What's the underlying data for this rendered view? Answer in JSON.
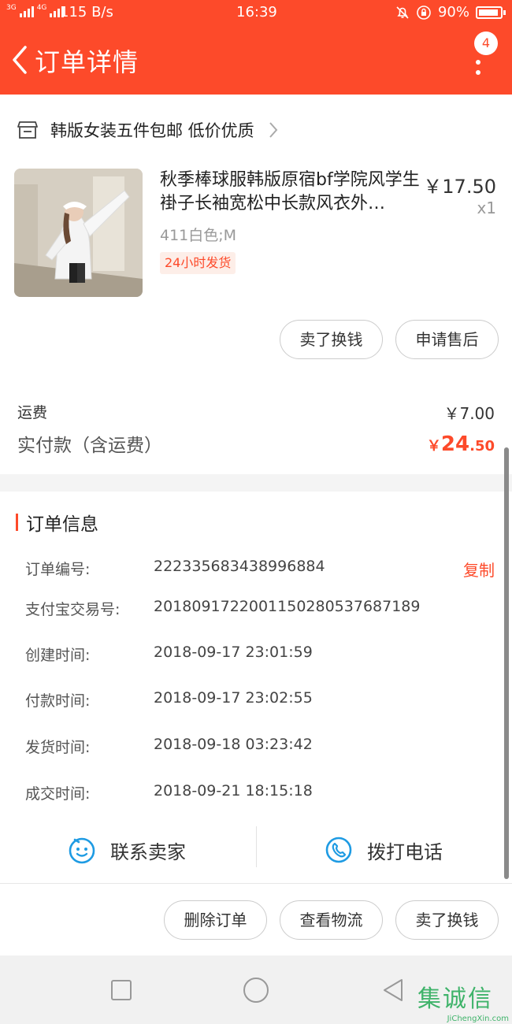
{
  "status_bar": {
    "sim1": "3G",
    "sim2": "4G",
    "net_speed": "115 B/s",
    "time": "16:39",
    "battery": "90%"
  },
  "header": {
    "title": "订单详情",
    "badge_count": "4"
  },
  "shop": {
    "name": "韩版女装五件包邮 低价优质"
  },
  "product": {
    "title": "秋季棒球服韩版原宿bf学院风学生褂子长袖宽松中长款风衣外…",
    "price": "￥17.50",
    "qty": "x1",
    "sku": "411白色;M",
    "tag": "24小时发货"
  },
  "item_actions": [
    "卖了换钱",
    "申请售后"
  ],
  "summary": {
    "shipping_label": "运费",
    "shipping_value": "￥7.00",
    "paid_label": "实付款（含运费）",
    "paid_currency": "￥",
    "paid_int": "24",
    "paid_dec": ".50"
  },
  "order_info": {
    "title": "订单信息",
    "copy": "复制",
    "rows": [
      {
        "label": "订单编号:",
        "value": "222335683438996884"
      },
      {
        "label": "支付宝交易号:",
        "value": "2018091722001150280537687189"
      },
      {
        "label": "创建时间:",
        "value": "2018-09-17 23:01:59"
      },
      {
        "label": "付款时间:",
        "value": "2018-09-17 23:02:55"
      },
      {
        "label": "发货时间:",
        "value": "2018-09-18 03:23:42"
      },
      {
        "label": "成交时间:",
        "value": "2018-09-21 18:15:18"
      }
    ]
  },
  "contact": {
    "seller": "联系卖家",
    "phone": "拨打电话"
  },
  "bottom_actions": [
    "删除订单",
    "查看物流",
    "卖了换钱"
  ],
  "watermark": {
    "cn": "集诚信",
    "en": "JiChengXin.com"
  },
  "colors": {
    "accent": "#fd4a2a",
    "contact_icon": "#1e9be3"
  }
}
